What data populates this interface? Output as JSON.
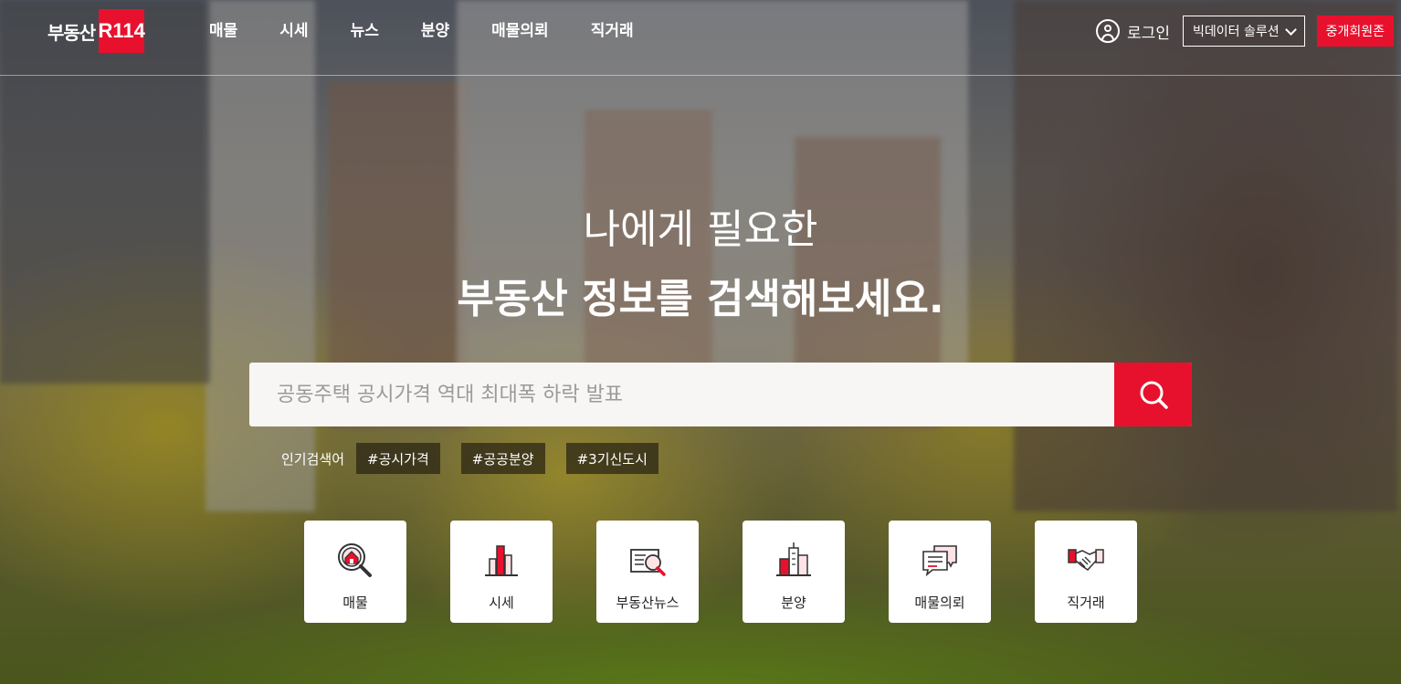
{
  "brand": {
    "name": "부동산",
    "badge": "R114",
    "accent": "#e8112d"
  },
  "nav": {
    "items": [
      {
        "label": "매물"
      },
      {
        "label": "시세"
      },
      {
        "label": "뉴스"
      },
      {
        "label": "분양"
      },
      {
        "label": "매물의뢰"
      },
      {
        "label": "직거래"
      }
    ]
  },
  "util": {
    "login_label": "로그인",
    "bigdata_label": "빅데이터 솔루션",
    "agent_label": "중개회원존"
  },
  "hero": {
    "line1": "나에게 필요한",
    "line2": "부동산 정보를 검색해보세요."
  },
  "search": {
    "placeholder": "공동주택 공시가격 역대 최대폭 하락 발표"
  },
  "popular": {
    "label": "인기검색어",
    "tags": [
      "#공시가격",
      "#공공분양",
      "#3기신도시"
    ]
  },
  "quick": {
    "items": [
      {
        "label": "매물",
        "icon": "house-search-icon"
      },
      {
        "label": "시세",
        "icon": "bar-chart-icon"
      },
      {
        "label": "부동산뉴스",
        "icon": "news-search-icon"
      },
      {
        "label": "분양",
        "icon": "buildings-icon"
      },
      {
        "label": "매물의뢰",
        "icon": "chat-bubbles-icon"
      },
      {
        "label": "직거래",
        "icon": "handshake-icon"
      }
    ]
  }
}
